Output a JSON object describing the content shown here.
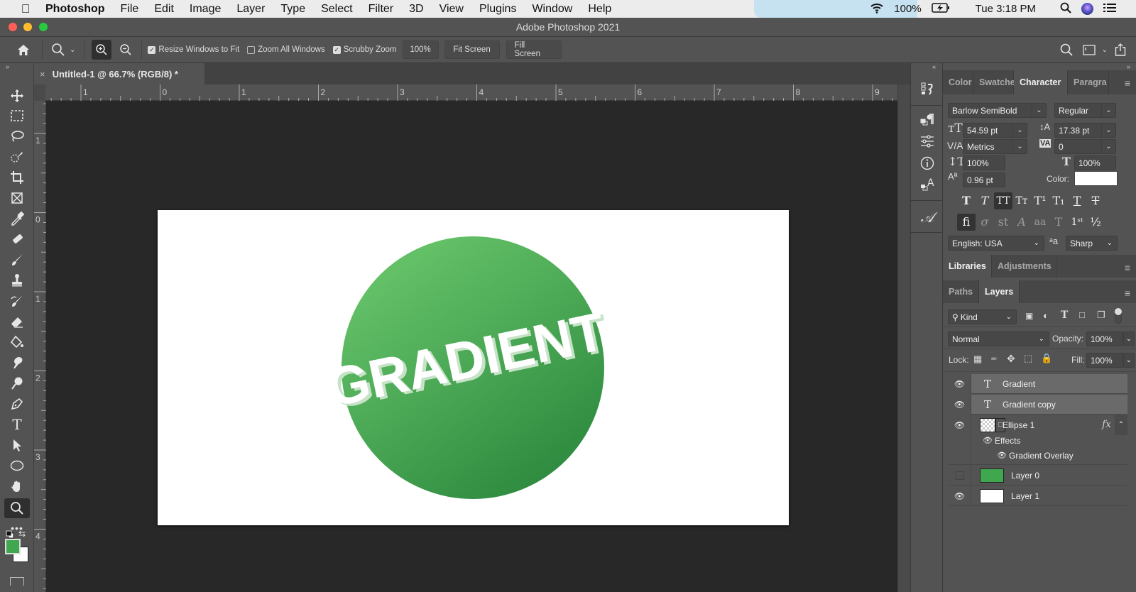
{
  "menubar": {
    "app_name": "Photoshop",
    "items": [
      "File",
      "Edit",
      "Image",
      "Layer",
      "Type",
      "Select",
      "Filter",
      "3D",
      "View",
      "Plugins",
      "Window",
      "Help"
    ],
    "battery": "100%",
    "clock": "Tue 3:18 PM"
  },
  "window": {
    "title": "Adobe Photoshop 2021"
  },
  "options_bar": {
    "resize_windows_to_fit": {
      "label": "Resize Windows to Fit",
      "checked": true
    },
    "zoom_all_windows": {
      "label": "Zoom All Windows",
      "checked": false
    },
    "scrubby_zoom": {
      "label": "Scrubby Zoom",
      "checked": true
    },
    "zoom_100": "100%",
    "fit_screen": "Fit Screen",
    "fill_screen": "Fill Screen"
  },
  "document": {
    "tab_title": "Untitled-1 @ 66.7% (RGB/8) *",
    "canvas_text": "GRADIENT",
    "circle_colors": {
      "light": "#63c067",
      "dark": "#2f8c40"
    },
    "hruler_labels": [
      "1",
      "0",
      "1",
      "2",
      "3",
      "4",
      "5",
      "6",
      "7",
      "8",
      "9"
    ],
    "vruler_labels": [
      "1",
      "0",
      "1",
      "2",
      "3",
      "4"
    ]
  },
  "colors": {
    "foreground": "#3fa84f",
    "background": "#ffffff"
  },
  "character_panel": {
    "tabs": [
      "Color",
      "Swatche",
      "Character",
      "Paragra"
    ],
    "selected_tab": "Character",
    "font_family": "Barlow SemiBold",
    "font_style": "Regular",
    "font_size": "54.59 pt",
    "leading": "17.38 pt",
    "kerning": "Metrics",
    "tracking": "0",
    "vertical_scale": "100%",
    "horizontal_scale": "100%",
    "baseline_shift": "0.96 pt",
    "color_label": "Color:",
    "language": "English: USA",
    "antialias": "Sharp"
  },
  "libraries_panel": {
    "tabs": [
      "Libraries",
      "Adjustments"
    ]
  },
  "layers_panel": {
    "tabs": [
      "Paths",
      "Layers"
    ],
    "filter_kind": "Kind",
    "blend_mode": "Normal",
    "opacity_label": "Opacity:",
    "opacity": "100%",
    "lock_label": "Lock:",
    "fill_label": "Fill:",
    "fill": "100%",
    "layers": [
      {
        "name": "Gradient",
        "type": "text",
        "visible": true,
        "selected": true
      },
      {
        "name": "Gradient copy",
        "type": "text",
        "visible": true,
        "selected": true
      },
      {
        "name": "Ellipse 1",
        "type": "shape",
        "visible": true,
        "selected": false,
        "fx": "fx"
      },
      {
        "name": "Layer 0",
        "type": "fill",
        "visible": false,
        "selected": false,
        "thumb": "#3fa84f"
      },
      {
        "name": "Layer 1",
        "type": "fill",
        "visible": true,
        "selected": false,
        "thumb": "#ffffff"
      }
    ],
    "effects_label": "Effects",
    "effect_item": "Gradient Overlay"
  }
}
